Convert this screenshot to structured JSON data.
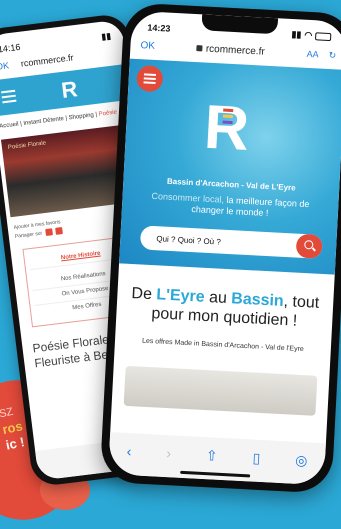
{
  "back_phone": {
    "time": "14:16",
    "ok": "OK",
    "url": "rcommerce.fr",
    "logo": "R",
    "breadcrumb": "Accueil | Instant Détente | Shopping |",
    "breadcrumb_active": "Poésie",
    "shop_sign": "Poésie Florale",
    "favorites": "Ajouter à mes favoris",
    "share": "Partager sur",
    "menu_title": "Notre Histoire",
    "menu": [
      "Nos Réalisations",
      "On Vous Propose",
      "Mes Offres"
    ],
    "shop_title": "Poésie Florale ~ Fleuriste à Belin-Béli"
  },
  "front_phone": {
    "time": "14:23",
    "ok": "OK",
    "url": "rcommerce.fr",
    "text_size": "AA",
    "reload": "↻",
    "logo": "R",
    "location": "Bassin d'Arcachon - Val de L'Eyre",
    "tagline_dim": "Consommer local,",
    "tagline": "la meilleure façon de changer le monde !",
    "search_placeholder": "Qui ? Quoi ? Où ?",
    "headline_1": "De",
    "headline_eyre": "L'Eyre",
    "headline_2": "au",
    "headline_bassin": "Bassin",
    "headline_3": ", tout pour mon quotidien !",
    "subline": "Les offres Made in Bassin d'Arcachon - Val de l'Eyre"
  },
  "promo": {
    "line1": "SZ",
    "line2": "ros",
    "line3": "ic !"
  },
  "colors": {
    "background": "#2ba8d6",
    "accent": "#e24a3a",
    "brand_blue": "#2ba8d6",
    "ios_blue": "#1f7ae0",
    "logo_bars": [
      "#e24a3a",
      "#f6c84a",
      "#7b4fc9"
    ]
  }
}
